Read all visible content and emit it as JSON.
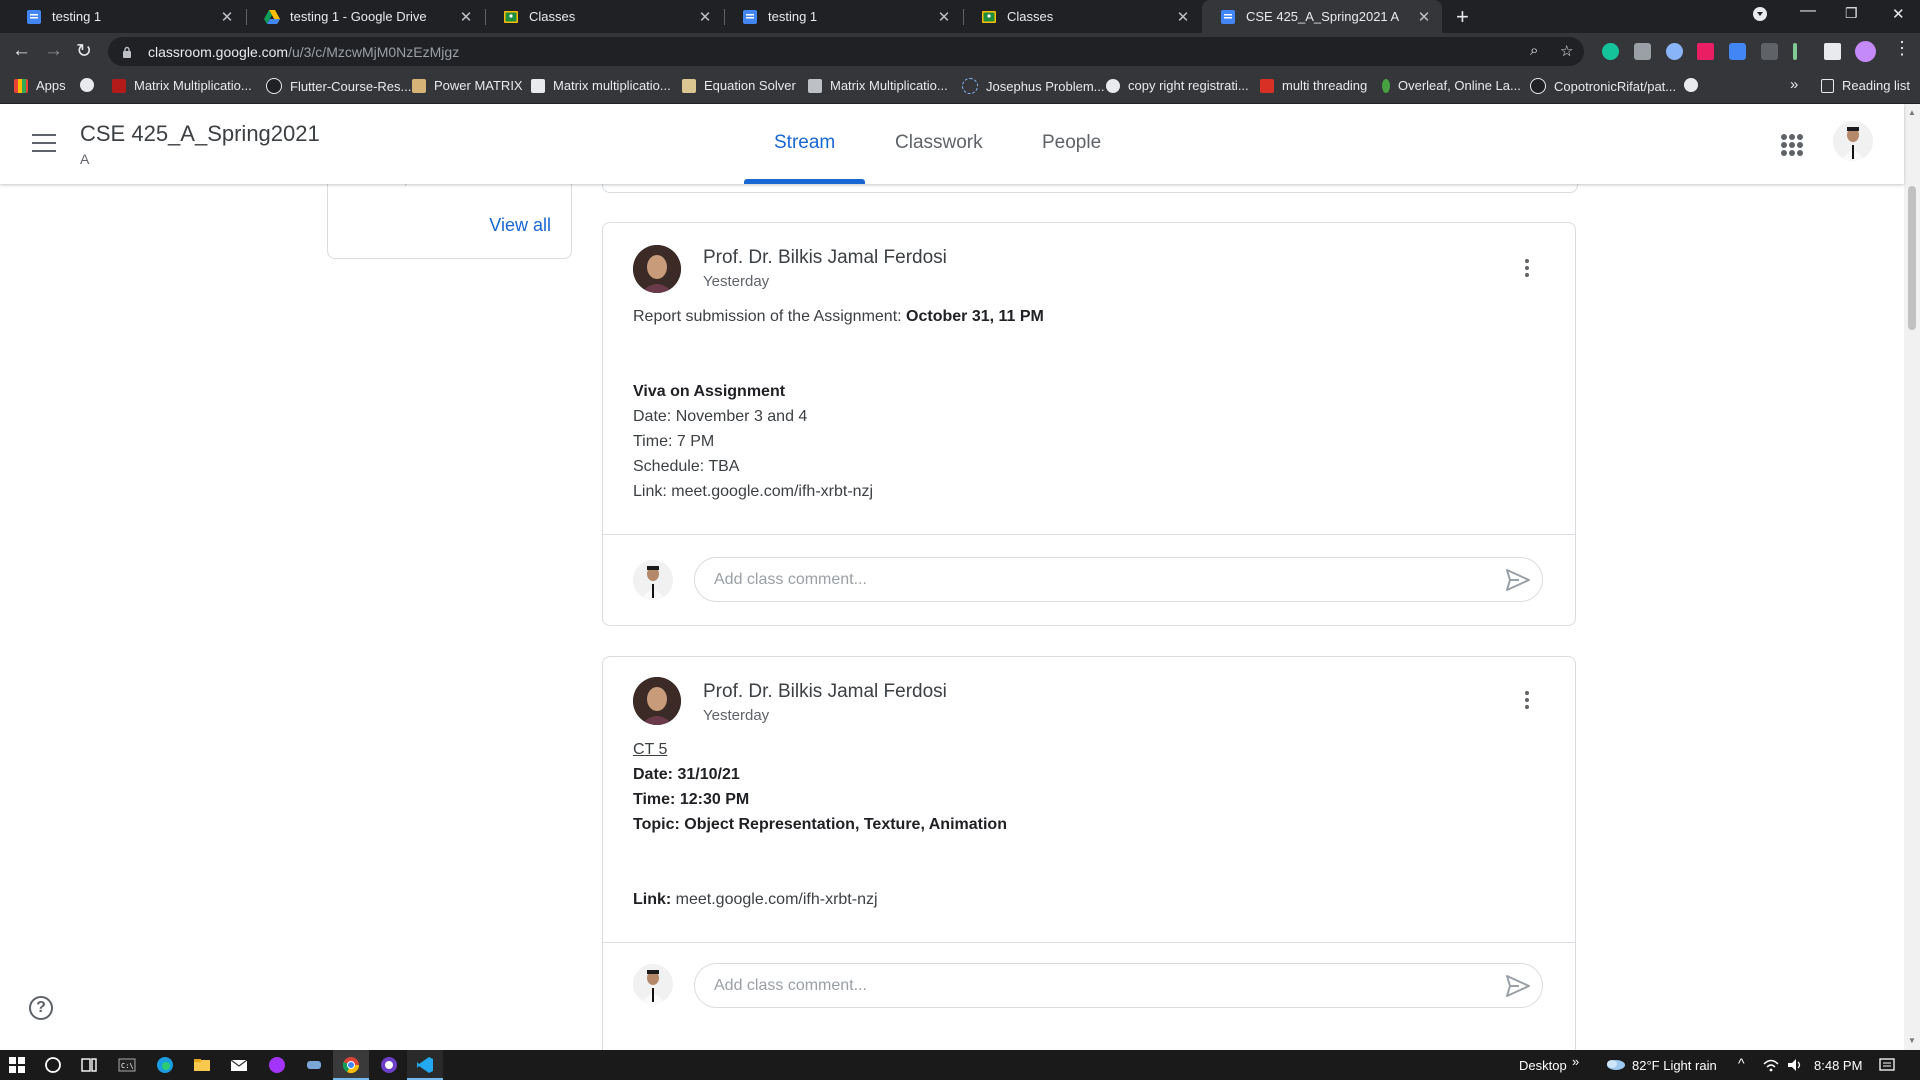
{
  "browser": {
    "tabs": [
      {
        "title": "testing 1",
        "icon": "google-docs-icon",
        "active": false
      },
      {
        "title": "testing 1 - Google Drive",
        "icon": "google-drive-icon",
        "active": false
      },
      {
        "title": "Classes",
        "icon": "google-classroom-icon",
        "active": false
      },
      {
        "title": "testing 1",
        "icon": "google-docs-icon",
        "active": false
      },
      {
        "title": "Classes",
        "icon": "google-classroom-icon",
        "active": false
      },
      {
        "title": "CSE 425_A_Spring2021 A",
        "icon": "google-classroom-icon",
        "active": true
      }
    ],
    "url_host": "classroom.google.com",
    "url_path": "/u/3/c/MzcwMjM0NzEzMjgz",
    "bookmarks": [
      {
        "label": "Apps",
        "icon": "apps-grid-icon"
      },
      {
        "label": "",
        "icon": "globe-icon"
      },
      {
        "label": "Matrix Multiplicatio...",
        "icon": "bookmark-site-icon"
      },
      {
        "label": "Flutter-Course-Res...",
        "icon": "github-icon"
      },
      {
        "label": "Power MATRIX",
        "icon": "bookmark-site-icon"
      },
      {
        "label": "Matrix multiplicatio...",
        "icon": "bookmark-site-icon"
      },
      {
        "label": "Equation Solver",
        "icon": "bookmark-site-icon"
      },
      {
        "label": "Matrix Multiplicatio...",
        "icon": "bookmark-site-icon"
      },
      {
        "label": "Josephus Problem...",
        "icon": "bookmark-site-icon"
      },
      {
        "label": "copy right registrati...",
        "icon": "globe-icon"
      },
      {
        "label": "multi threading",
        "icon": "bookmark-site-icon"
      },
      {
        "label": "Overleaf, Online La...",
        "icon": "overleaf-icon"
      },
      {
        "label": "CopotronicRifat/pat...",
        "icon": "github-icon"
      },
      {
        "label": "",
        "icon": "globe-icon"
      }
    ],
    "more_bookmarks": "»",
    "reading_list": "Reading list"
  },
  "classroom": {
    "course_title": "CSE 425_A_Spring2021",
    "course_section": "A",
    "nav_tabs": [
      {
        "label": "Stream",
        "active": true
      },
      {
        "label": "Classwork",
        "active": false
      },
      {
        "label": "People",
        "active": false
      }
    ],
    "upcoming": {
      "cut_text": "Woohoo, no work due soon!",
      "view_all": "View all"
    },
    "posts": [
      {
        "author": "Prof. Dr. Bilkis Jamal Ferdosi",
        "when": "Yesterday",
        "report_prefix": "Report submission of the Assignment: ",
        "report_deadline": "October 31, 11 PM",
        "viva_heading": "Viva on Assignment",
        "viva_date": "Date: November 3 and 4",
        "viva_time": "Time: 7 PM",
        "viva_schedule": "Schedule: TBA",
        "viva_link": "Link: meet.google.com/ifh-xrbt-nzj",
        "comment_placeholder": "Add class comment..."
      },
      {
        "author": "Prof. Dr. Bilkis Jamal Ferdosi",
        "when": "Yesterday",
        "ct_title": "CT 5",
        "ct_date": "Date: 31/10/21",
        "ct_time": "Time: 12:30 PM",
        "ct_topic": "Topic: Object Representation, Texture, Animation",
        "link_label": "Link:",
        "link_url": " meet.google.com/ifh-xrbt-nzj",
        "comment_placeholder": "Add class comment..."
      }
    ],
    "help": "?"
  },
  "taskbar": {
    "desktop_label": "Desktop",
    "desktop_arrow": "»",
    "weather": "82°F  Light rain",
    "clock": "8:48 PM"
  },
  "colors": {
    "accent": "#1967d2",
    "chrome_dark": "#202124",
    "chrome_toolbar": "#35363a",
    "taskbar": "#1a1a1a"
  }
}
